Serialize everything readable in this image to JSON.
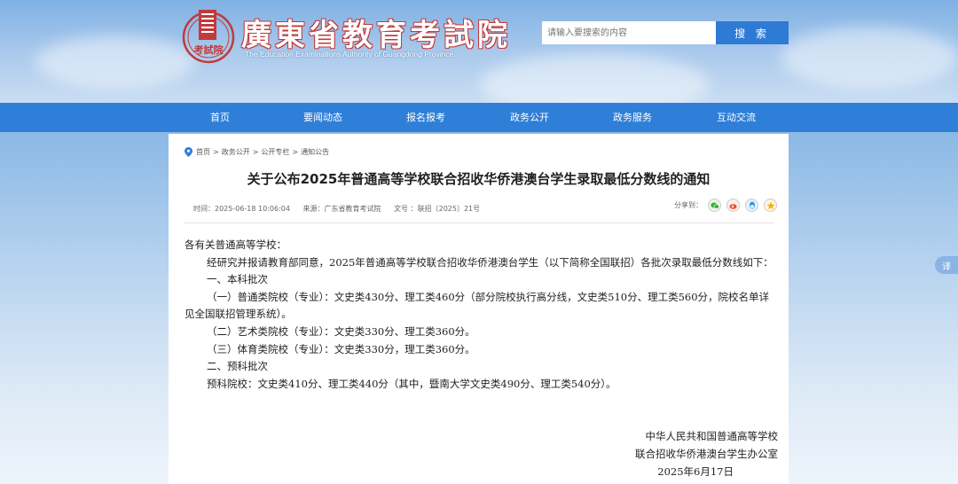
{
  "header": {
    "logo_text": "考試院",
    "site_title": "廣東省教育考試院",
    "site_subtitle": "The Education Examinations Authority of Guangdong Province",
    "search_placeholder": "请输入要搜索的内容",
    "search_button": "搜 索"
  },
  "nav": {
    "items": [
      "首页",
      "要闻动态",
      "报名报考",
      "政务公开",
      "政务服务",
      "互动交流"
    ]
  },
  "breadcrumb": [
    "首页",
    "政务公开",
    "公开专栏",
    "通知公告"
  ],
  "article": {
    "title": "关于公布2025年普通高等学校联合招收华侨港澳台学生录取最低分数线的通知",
    "meta": {
      "time": "时间：2025-06-18 10:06:04",
      "source": "来源：广东省教育考试院",
      "doc_no": "文号 ：联招〔2025〕21号"
    },
    "share_label": "分享到：",
    "share_icons": [
      "wechat-icon",
      "weibo-icon",
      "qq-icon",
      "qzone-icon"
    ],
    "paragraphs": [
      "各有关普通高等学校：",
      "经研究并报请教育部同意，2025年普通高等学校联合招收华侨港澳台学生（以下简称全国联招）各批次录取最低分数线如下：",
      "一、本科批次",
      "（一）普通类院校（专业）：文史类430分、理工类460分（部分院校执行高分线，文史类510分、理工类560分，院校名单详见全国联招管理系统）。",
      "（二）艺术类院校（专业）：文史类330分、理工类360分。",
      "（三）体育类院校（专业）：文史类330分，理工类360分。",
      "二、预科批次",
      "预科院校：文史类410分、理工类440分（其中，暨南大学文史类490分、理工类540分）。"
    ],
    "signature": {
      "line1": "中华人民共和国普通高等学校",
      "line2": "联合招收华侨港澳台学生办公室",
      "date": "2025年6月17日"
    }
  },
  "translate_label": "译",
  "colors": {
    "nav_bg": "#2f7fd8",
    "search_btn": "#2e7bd6",
    "seal_red": "#c23a3a"
  }
}
